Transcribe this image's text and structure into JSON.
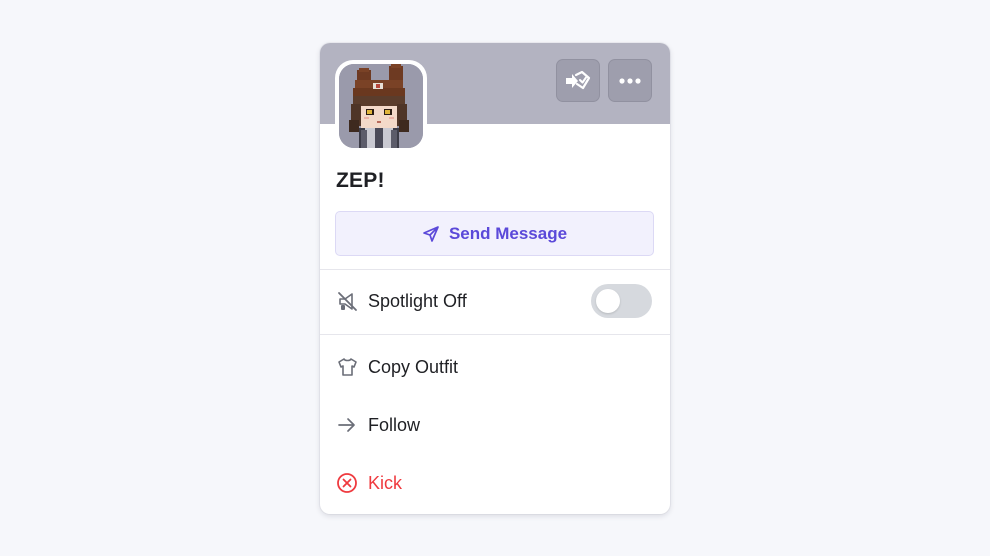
{
  "profile": {
    "name": "ZEP!",
    "avatar_icon": "pixel-character-avatar"
  },
  "header": {
    "transfer_icon": "transfer-host-icon",
    "more_icon": "more-options-icon"
  },
  "actions": {
    "send_message_label": "Send Message",
    "send_icon": "send-icon"
  },
  "spotlight": {
    "label": "Spotlight Off",
    "icon": "spotlight-off-icon",
    "enabled": false
  },
  "menu": {
    "copy_outfit": {
      "label": "Copy Outfit",
      "icon": "shirt-icon"
    },
    "follow": {
      "label": "Follow",
      "icon": "arrow-right-icon"
    },
    "kick": {
      "label": "Kick",
      "icon": "circle-x-icon"
    }
  },
  "colors": {
    "accent": "#5b49d9",
    "danger": "#ef3a3f",
    "banner": "#b3b3c1",
    "toggle_off": "#d6d9de"
  }
}
